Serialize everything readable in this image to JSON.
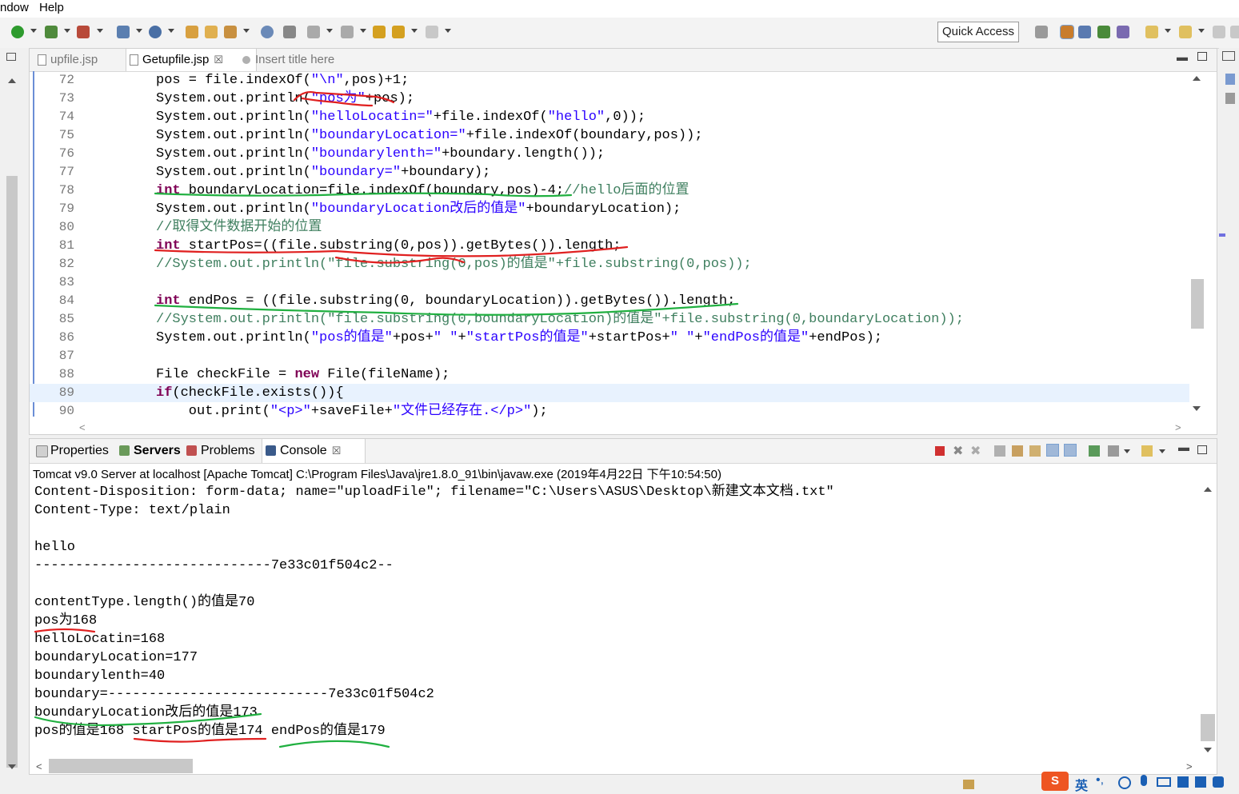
{
  "menu": {
    "window": "ndow",
    "help": "Help"
  },
  "toolbar": {
    "quick_access": "Quick Access"
  },
  "editor": {
    "tabs": [
      {
        "label": "upfile.jsp"
      },
      {
        "label": "Getupfile.jsp",
        "close": "☒"
      },
      {
        "label": "Insert title here"
      }
    ],
    "lines": [
      {
        "num": "72",
        "text": "pos = file.indexOf(\"\\n\",pos)+1;"
      },
      {
        "num": "73",
        "text": "System.out.println(\"pos为\"+pos);"
      },
      {
        "num": "74",
        "text": "System.out.println(\"helloLocatin=\"+file.indexOf(\"hello\",0));"
      },
      {
        "num": "75",
        "text": "System.out.println(\"boundaryLocation=\"+file.indexOf(boundary,pos));"
      },
      {
        "num": "76",
        "text": "System.out.println(\"boundarylenth=\"+boundary.length());"
      },
      {
        "num": "77",
        "text": "System.out.println(\"boundary=\"+boundary);"
      },
      {
        "num": "78",
        "text": "int boundaryLocation=file.indexOf(boundary,pos)-4;//hello后面的位置"
      },
      {
        "num": "79",
        "text": "System.out.println(\"boundaryLocation改后的值是\"+boundaryLocation);"
      },
      {
        "num": "80",
        "text": "//取得文件数据开始的位置"
      },
      {
        "num": "81",
        "text": "int startPos=((file.substring(0,pos)).getBytes()).length;"
      },
      {
        "num": "82",
        "text": "//System.out.println(\"file.substring(0,pos)的值是\"+file.substring(0,pos));"
      },
      {
        "num": "83",
        "text": ""
      },
      {
        "num": "84",
        "text": "int endPos = ((file.substring(0, boundaryLocation)).getBytes()).length;"
      },
      {
        "num": "85",
        "text": "//System.out.println(\"file.substring(0,boundaryLocation)的值是\"+file.substring(0,boundaryLocation));"
      },
      {
        "num": "86",
        "text": "System.out.println(\"pos的值是\"+pos+\" \"+\"startPos的值是\"+startPos+\" \"+\"endPos的值是\"+endPos);"
      },
      {
        "num": "87",
        "text": ""
      },
      {
        "num": "88",
        "text": "File checkFile = new File(fileName);"
      },
      {
        "num": "89",
        "text": "if(checkFile.exists()){"
      },
      {
        "num": "90",
        "text": "    out.print(\"<p>\"+saveFile+\"文件已经存在.</p>\");"
      }
    ]
  },
  "console": {
    "tabs": [
      {
        "label": "Properties"
      },
      {
        "label": "Servers"
      },
      {
        "label": "Problems"
      },
      {
        "label": "Console",
        "close": "☒"
      }
    ],
    "info": "Tomcat v9.0 Server at localhost [Apache Tomcat] C:\\Program Files\\Java\\jre1.8.0_91\\bin\\javaw.exe (2019年4月22日 下午10:54:50)",
    "output": [
      "Content-Disposition: form-data; name=\"uploadFile\"; filename=\"C:\\Users\\ASUS\\Desktop\\新建文本文档.txt\"",
      "Content-Type: text/plain",
      "",
      "hello",
      "-----------------------------7e33c01f504c2--",
      "",
      "contentType.length()的值是70",
      "pos为168",
      "helloLocatin=168",
      "boundaryLocation=177",
      "boundarylenth=40",
      "boundary=---------------------------7e33c01f504c2",
      "boundaryLocation改后的值是173",
      "pos的值是168 startPos的值是174 endPos的值是179"
    ]
  },
  "ime": {
    "lang": "英"
  },
  "colors": {
    "keyword": "#7f0055",
    "string": "#2a00ff",
    "comment": "#3f7f5f",
    "annotation_red": "#e02020",
    "annotation_green": "#20b040"
  }
}
